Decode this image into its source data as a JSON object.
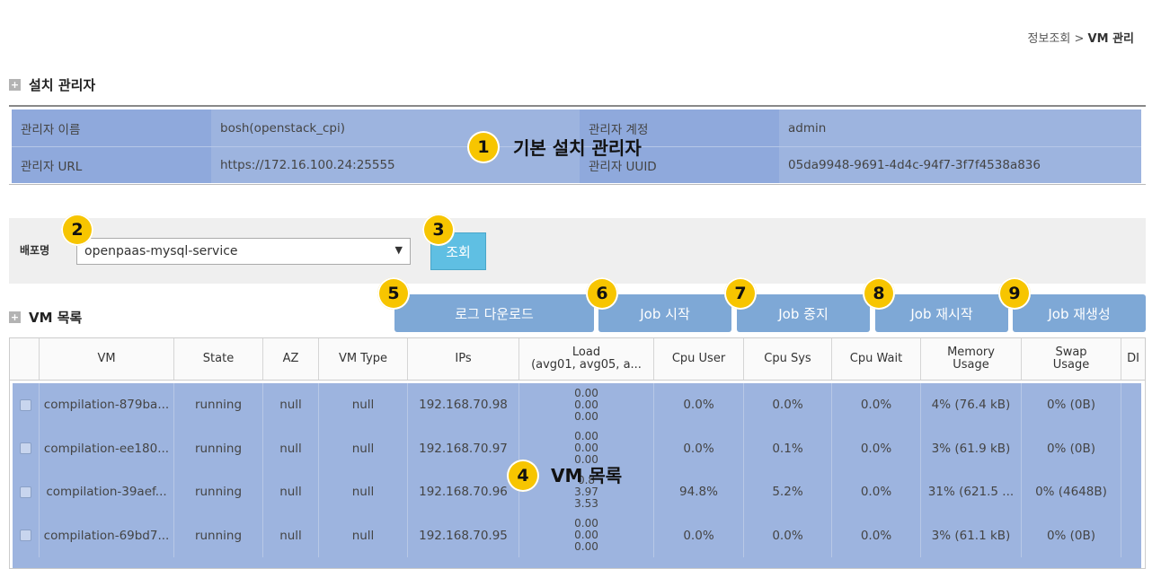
{
  "breadcrumb": {
    "parent": "정보조회",
    "sep": ">",
    "current": "VM 관리"
  },
  "manager_section": {
    "title": "설치 관리자",
    "rows": [
      {
        "label1": "관리자 이름",
        "value1": "bosh(openstack_cpi)",
        "label2": "관리자 계정",
        "value2": "admin"
      },
      {
        "label1": "관리자 URL",
        "value1": "https://172.16.100.24:25555",
        "label2": "관리자 UUID",
        "value2": "05da9948-9691-4d4c-94f7-3f7f4538a836"
      }
    ]
  },
  "deploy": {
    "label": "배포명",
    "selected": "openpaas-mysql-service",
    "query_btn": "조회"
  },
  "vm_section": {
    "title": "VM 목록"
  },
  "actions": [
    "로그 다운로드",
    "Job 시작",
    "Job 중지",
    "Job 재시작",
    "Job 재생성"
  ],
  "table": {
    "headers": [
      "",
      "VM",
      "State",
      "AZ",
      "VM Type",
      "IPs",
      "Load\n(avg01, avg05, a...",
      "Cpu User",
      "Cpu Sys",
      "Cpu Wait",
      "Memory\nUsage",
      "Swap\nUsage",
      "DI"
    ],
    "rows": [
      {
        "vm": "compilation-879ba...",
        "state": "running",
        "az": "null",
        "type": "null",
        "ip": "192.168.70.98",
        "load": [
          "0.00",
          "0.00",
          "0.00"
        ],
        "cpu_user": "0.0%",
        "cpu_sys": "0.0%",
        "cpu_wait": "0.0%",
        "mem": "4% (76.4 kB)",
        "swap": "0% (0B)"
      },
      {
        "vm": "compilation-ee180...",
        "state": "running",
        "az": "null",
        "type": "null",
        "ip": "192.168.70.97",
        "load": [
          "0.00",
          "0.00",
          "0.00"
        ],
        "cpu_user": "0.0%",
        "cpu_sys": "0.1%",
        "cpu_wait": "0.0%",
        "mem": "3% (61.9 kB)",
        "swap": "0% (0B)"
      },
      {
        "vm": "compilation-39aef...",
        "state": "running",
        "az": "null",
        "type": "null",
        "ip": "192.168.70.96",
        "load": [
          "0.8",
          "3.97",
          "3.53"
        ],
        "cpu_user": "94.8%",
        "cpu_sys": "5.2%",
        "cpu_wait": "0.0%",
        "mem": "31% (621.5 ...",
        "swap": "0% (4648B)"
      },
      {
        "vm": "compilation-69bd7...",
        "state": "running",
        "az": "null",
        "type": "null",
        "ip": "192.168.70.95",
        "load": [
          "0.00",
          "0.00",
          "0.00"
        ],
        "cpu_user": "0.0%",
        "cpu_sys": "0.0%",
        "cpu_wait": "0.0%",
        "mem": "3% (61.1 kB)",
        "swap": "0% (0B)"
      }
    ]
  },
  "annotations": {
    "badges": [
      "1",
      "2",
      "3",
      "4",
      "5",
      "6",
      "7",
      "8",
      "9"
    ],
    "label_1": "기본 설치 관리자",
    "label_4": "VM 목록"
  },
  "colors": {
    "highlight": "#9db4df",
    "badge": "#f7c500",
    "action_btn": "#7ea8d6",
    "query_btn": "#5fbfe3"
  }
}
